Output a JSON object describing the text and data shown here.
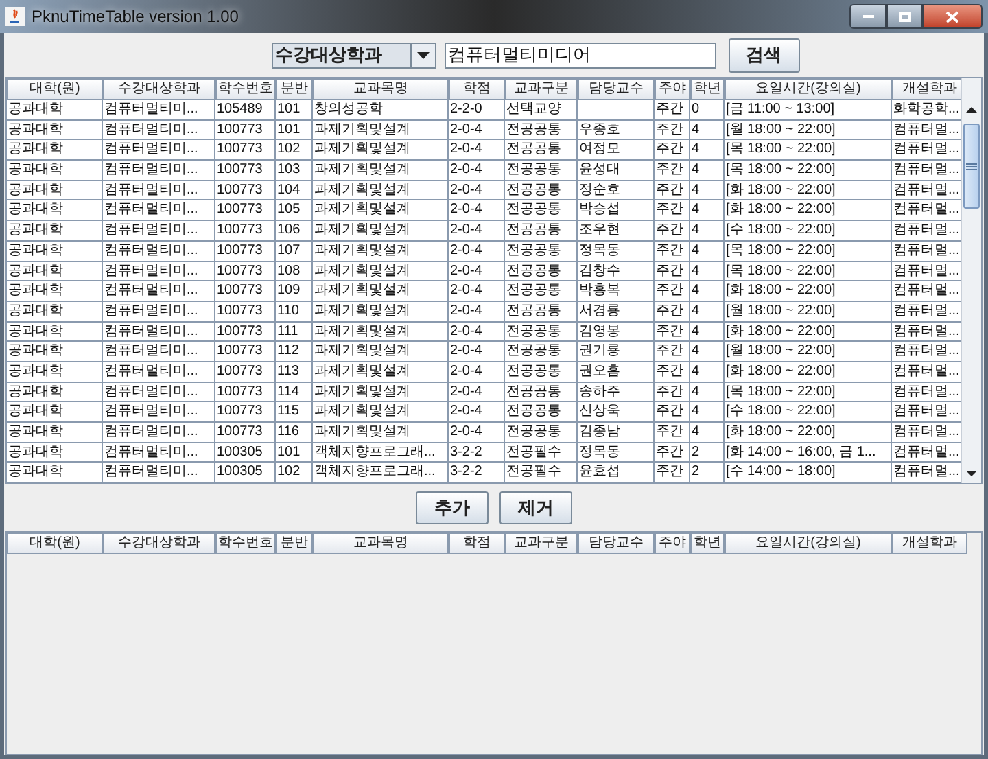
{
  "window": {
    "title": "PknuTimeTable version 1.00"
  },
  "search": {
    "category": "수강대상학과",
    "value": "컴퓨터멀티미디어",
    "button": "검색"
  },
  "columns": [
    "대학(원)",
    "수강대상학과",
    "학수번호",
    "분반",
    "교과목명",
    "학점",
    "교과구분",
    "담당교수",
    "주야",
    "학년",
    "요일시간(강의실)",
    "개설학과"
  ],
  "rows": [
    [
      "공과대학",
      "컴퓨터멀티미...",
      "105489",
      "101",
      "창의성공학",
      "2-2-0",
      "선택교양",
      null,
      "주간",
      "0",
      "[금 11:00 ~ 13:00]",
      "화학공학..."
    ],
    [
      "공과대학",
      "컴퓨터멀티미...",
      "100773",
      "101",
      "과제기획및설계",
      "2-0-4",
      "전공공통",
      "우종호",
      "주간",
      "4",
      "[월 18:00 ~ 22:00]",
      "컴퓨터멀..."
    ],
    [
      "공과대학",
      "컴퓨터멀티미...",
      "100773",
      "102",
      "과제기획및설계",
      "2-0-4",
      "전공공통",
      "여정모",
      "주간",
      "4",
      "[목 18:00 ~ 22:00]",
      "컴퓨터멀..."
    ],
    [
      "공과대학",
      "컴퓨터멀티미...",
      "100773",
      "103",
      "과제기획및설계",
      "2-0-4",
      "전공공통",
      "윤성대",
      "주간",
      "4",
      "[목 18:00 ~ 22:00]",
      "컴퓨터멀..."
    ],
    [
      "공과대학",
      "컴퓨터멀티미...",
      "100773",
      "104",
      "과제기획및설계",
      "2-0-4",
      "전공공통",
      "정순호",
      "주간",
      "4",
      "[화 18:00 ~ 22:00]",
      "컴퓨터멀..."
    ],
    [
      "공과대학",
      "컴퓨터멀티미...",
      "100773",
      "105",
      "과제기획및설계",
      "2-0-4",
      "전공공통",
      "박승섭",
      "주간",
      "4",
      "[화 18:00 ~ 22:00]",
      "컴퓨터멀..."
    ],
    [
      "공과대학",
      "컴퓨터멀티미...",
      "100773",
      "106",
      "과제기획및설계",
      "2-0-4",
      "전공공통",
      "조우현",
      "주간",
      "4",
      "[수 18:00 ~ 22:00]",
      "컴퓨터멀..."
    ],
    [
      "공과대학",
      "컴퓨터멀티미...",
      "100773",
      "107",
      "과제기획및설계",
      "2-0-4",
      "전공공통",
      "정목동",
      "주간",
      "4",
      "[목 18:00 ~ 22:00]",
      "컴퓨터멀..."
    ],
    [
      "공과대학",
      "컴퓨터멀티미...",
      "100773",
      "108",
      "과제기획및설계",
      "2-0-4",
      "전공공통",
      "김창수",
      "주간",
      "4",
      "[목 18:00 ~ 22:00]",
      "컴퓨터멀..."
    ],
    [
      "공과대학",
      "컴퓨터멀티미...",
      "100773",
      "109",
      "과제기획및설계",
      "2-0-4",
      "전공공통",
      "박홍복",
      "주간",
      "4",
      "[화 18:00 ~ 22:00]",
      "컴퓨터멀..."
    ],
    [
      "공과대학",
      "컴퓨터멀티미...",
      "100773",
      "110",
      "과제기획및설계",
      "2-0-4",
      "전공공통",
      "서경룡",
      "주간",
      "4",
      "[월 18:00 ~ 22:00]",
      "컴퓨터멀..."
    ],
    [
      "공과대학",
      "컴퓨터멀티미...",
      "100773",
      "111",
      "과제기획및설계",
      "2-0-4",
      "전공공통",
      "김영봉",
      "주간",
      "4",
      "[화 18:00 ~ 22:00]",
      "컴퓨터멀..."
    ],
    [
      "공과대학",
      "컴퓨터멀티미...",
      "100773",
      "112",
      "과제기획및설계",
      "2-0-4",
      "전공공통",
      "권기룡",
      "주간",
      "4",
      "[월 18:00 ~ 22:00]",
      "컴퓨터멀..."
    ],
    [
      "공과대학",
      "컴퓨터멀티미...",
      "100773",
      "113",
      "과제기획및설계",
      "2-0-4",
      "전공공통",
      "권오흠",
      "주간",
      "4",
      "[화 18:00 ~ 22:00]",
      "컴퓨터멀..."
    ],
    [
      "공과대학",
      "컴퓨터멀티미...",
      "100773",
      "114",
      "과제기획및설계",
      "2-0-4",
      "전공공통",
      "송하주",
      "주간",
      "4",
      "[목 18:00 ~ 22:00]",
      "컴퓨터멀..."
    ],
    [
      "공과대학",
      "컴퓨터멀티미...",
      "100773",
      "115",
      "과제기획및설계",
      "2-0-4",
      "전공공통",
      "신상욱",
      "주간",
      "4",
      "[수 18:00 ~ 22:00]",
      "컴퓨터멀..."
    ],
    [
      "공과대학",
      "컴퓨터멀티미...",
      "100773",
      "116",
      "과제기획및설계",
      "2-0-4",
      "전공공통",
      "김종남",
      "주간",
      "4",
      "[화 18:00 ~ 22:00]",
      "컴퓨터멀..."
    ],
    [
      "공과대학",
      "컴퓨터멀티미...",
      "100305",
      "101",
      "객체지향프로그래...",
      "3-2-2",
      "전공필수",
      "정목동",
      "주간",
      "2",
      "[화 14:00 ~ 16:00, 금 1...",
      "컴퓨터멀..."
    ],
    [
      "공과대학",
      "컴퓨터멀티미...",
      "100305",
      "102",
      "객체지향프로그래...",
      "3-2-2",
      "전공필수",
      "윤효섭",
      "주간",
      "2",
      "[수 14:00 ~ 18:00]",
      "컴퓨터멀..."
    ]
  ],
  "actions": [
    "추가",
    "제거"
  ],
  "selected_columns": [
    "대학(원)",
    "수강대상학과",
    "학수번호",
    "분반",
    "교과목명",
    "학점",
    "교과구분",
    "담당교수",
    "주야",
    "학년",
    "요일시간(강의실)",
    "개설학과"
  ]
}
